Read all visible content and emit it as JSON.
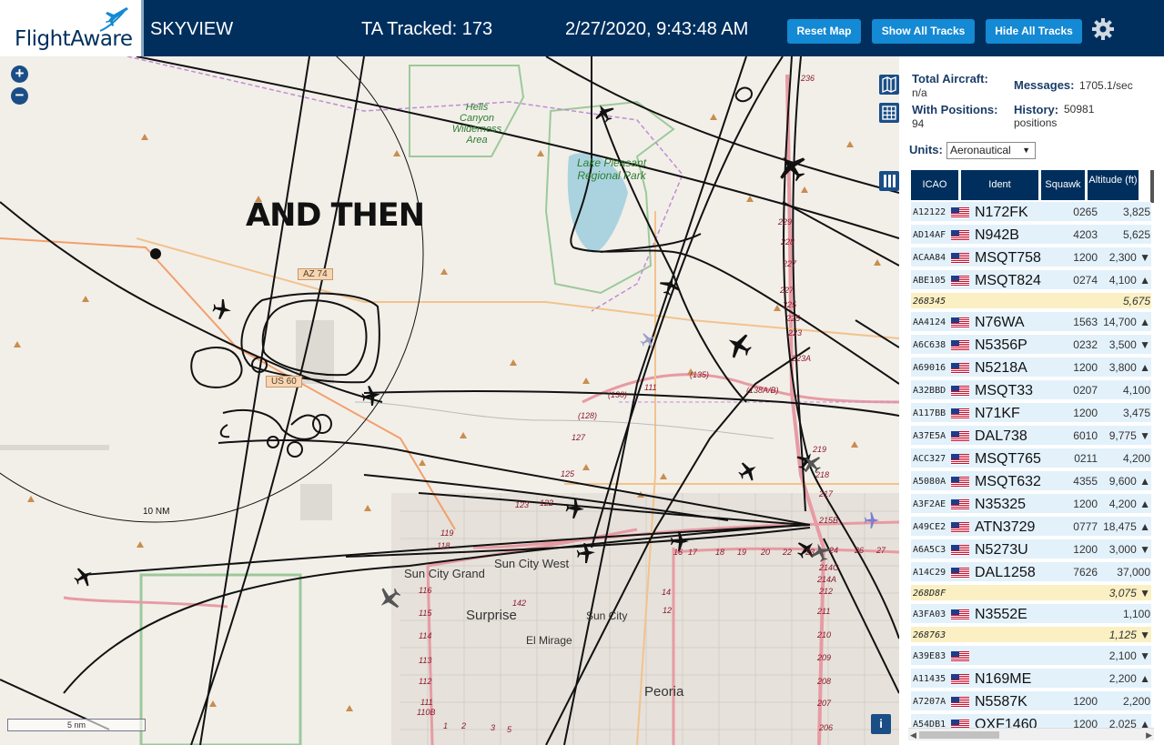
{
  "header": {
    "logo": "FlightAware",
    "app_name": "SKYVIEW",
    "tracked": "TA Tracked: 173",
    "datetime": "2/27/2020, 9:43:48 AM",
    "buttons": {
      "reset": "Reset Map",
      "show_all": "Show All Tracks",
      "hide_all": "Hide All Tracks"
    },
    "colors": {
      "bar": "#002f5d",
      "button": "#1489d4"
    }
  },
  "map": {
    "overlay_text": "AND THEN",
    "range_label": "10 NM",
    "scale_label": "5 nm",
    "labels": {
      "hells_canyon": "Hells Canyon Wilderness Area",
      "lake_pleasant": "Lake Pleasant Regional Park",
      "az74": "AZ 74",
      "us60": "US 60",
      "sun_city_grand": "Sun City Grand",
      "sun_city_west": "Sun City West",
      "surprise": "Surprise",
      "sun_city": "Sun City",
      "el_mirage": "El Mirage",
      "peoria": "Peoria"
    },
    "exits": [
      "236",
      "229",
      "227",
      "225",
      "223",
      "223A",
      "219",
      "218",
      "217",
      "215B",
      "214C",
      "214A",
      "212",
      "211",
      "210",
      "209",
      "208",
      "207",
      "206",
      "(135)",
      "(130)",
      "(128)",
      "127",
      "125",
      "123",
      "122",
      "119",
      "118",
      "116",
      "115",
      "114",
      "113",
      "112",
      "111",
      "110B",
      "16",
      "17",
      "18",
      "19",
      "20",
      "22",
      "23",
      "24",
      "26",
      "27",
      "142",
      "14",
      "12",
      "1",
      "2",
      "3",
      "5"
    ],
    "zoom_in": "+",
    "zoom_out": "−",
    "info": "i"
  },
  "panel": {
    "total_aircraft_label": "Total Aircraft:",
    "total_aircraft_value": "n/a",
    "with_positions_label": "With Positions:",
    "with_positions_value": "94",
    "messages_label": "Messages:",
    "messages_value": "1705.1/sec",
    "history_label": "History:",
    "history_value": "50981 positions",
    "units_label": "Units:",
    "units_value": "Aeronautical",
    "columns": [
      "ICAO",
      "Ident",
      "Squawk",
      "Altitude (ft)"
    ],
    "rows": [
      {
        "icao": "A12122",
        "flag": true,
        "ident": "N172FK",
        "squawk": "0265",
        "alt": "3,825",
        "hl": false
      },
      {
        "icao": "AD14AF",
        "flag": true,
        "ident": "N942B",
        "squawk": "4203",
        "alt": "5,625",
        "hl": false
      },
      {
        "icao": "ACAA84",
        "flag": true,
        "ident": "MSQT758",
        "squawk": "1200",
        "alt": "2,300 ▼",
        "hl": false
      },
      {
        "icao": "ABE105",
        "flag": true,
        "ident": "MSQT824",
        "squawk": "0274",
        "alt": "4,100 ▲",
        "hl": false
      },
      {
        "icao": "268345",
        "flag": false,
        "ident": "",
        "squawk": "",
        "alt": "5,675",
        "hl": true
      },
      {
        "icao": "AA4124",
        "flag": true,
        "ident": "N76WA",
        "squawk": "1563",
        "alt": "14,700 ▲",
        "hl": false
      },
      {
        "icao": "A6C638",
        "flag": true,
        "ident": "N5356P",
        "squawk": "0232",
        "alt": "3,500 ▼",
        "hl": false
      },
      {
        "icao": "A69016",
        "flag": true,
        "ident": "N5218A",
        "squawk": "1200",
        "alt": "3,800 ▲",
        "hl": false
      },
      {
        "icao": "A32BBD",
        "flag": true,
        "ident": "MSQT33",
        "squawk": "0207",
        "alt": "4,100",
        "hl": false
      },
      {
        "icao": "A117BB",
        "flag": true,
        "ident": "N71KF",
        "squawk": "1200",
        "alt": "3,475",
        "hl": false
      },
      {
        "icao": "A37E5A",
        "flag": true,
        "ident": "DAL738",
        "squawk": "6010",
        "alt": "9,775 ▼",
        "hl": false
      },
      {
        "icao": "ACC327",
        "flag": true,
        "ident": "MSQT765",
        "squawk": "0211",
        "alt": "4,200",
        "hl": false
      },
      {
        "icao": "A5080A",
        "flag": true,
        "ident": "MSQT632",
        "squawk": "4355",
        "alt": "9,600 ▲",
        "hl": false
      },
      {
        "icao": "A3F2AE",
        "flag": true,
        "ident": "N35325",
        "squawk": "1200",
        "alt": "4,200 ▲",
        "hl": false
      },
      {
        "icao": "A49CE2",
        "flag": true,
        "ident": "ATN3729",
        "squawk": "0777",
        "alt": "18,475 ▲",
        "hl": false
      },
      {
        "icao": "A6A5C3",
        "flag": true,
        "ident": "N5273U",
        "squawk": "1200",
        "alt": "3,000 ▼",
        "hl": false
      },
      {
        "icao": "A14C29",
        "flag": true,
        "ident": "DAL1258",
        "squawk": "7626",
        "alt": "37,000",
        "hl": false
      },
      {
        "icao": "268D8F",
        "flag": false,
        "ident": "",
        "squawk": "",
        "alt": "3,075 ▼",
        "hl": true
      },
      {
        "icao": "A3FA03",
        "flag": true,
        "ident": "N3552E",
        "squawk": "",
        "alt": "1,100",
        "hl": false
      },
      {
        "icao": "268763",
        "flag": false,
        "ident": "",
        "squawk": "",
        "alt": "1,125 ▼",
        "hl": true
      },
      {
        "icao": "A39E83",
        "flag": true,
        "ident": "",
        "squawk": "",
        "alt": "2,100 ▼",
        "hl": false
      },
      {
        "icao": "A11435",
        "flag": true,
        "ident": "N169ME",
        "squawk": "",
        "alt": "2,200 ▲",
        "hl": false
      },
      {
        "icao": "A7207A",
        "flag": true,
        "ident": "N5587K",
        "squawk": "1200",
        "alt": "2,200",
        "hl": false
      },
      {
        "icao": "A54DB1",
        "flag": true,
        "ident": "OXF1460",
        "squawk": "1200",
        "alt": "2,025 ▲",
        "hl": false
      }
    ]
  }
}
